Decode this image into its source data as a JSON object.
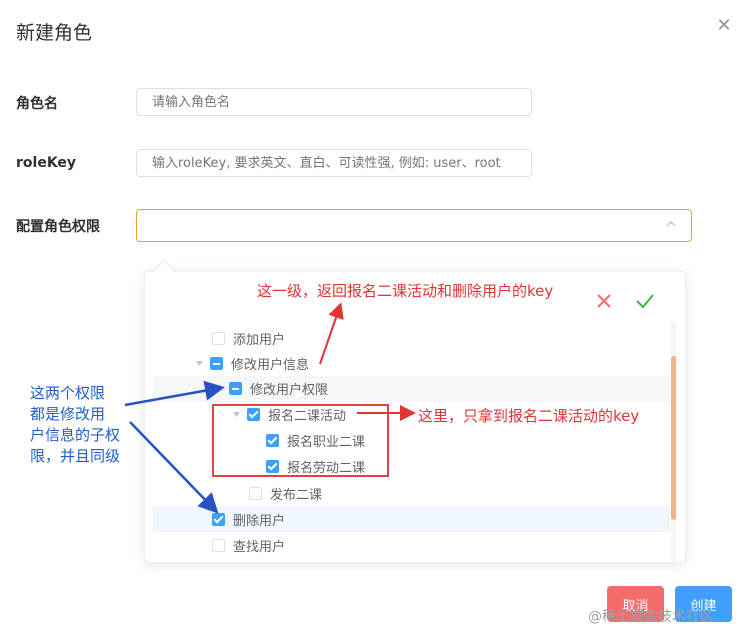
{
  "dialog": {
    "title": "新建角色",
    "close_icon": "close-icon"
  },
  "form": {
    "role_name": {
      "label": "角色名",
      "placeholder": "请输入角色名"
    },
    "role_key": {
      "label": "roleKey",
      "placeholder": "输入roleKey, 要求英文、直白、可读性强, 例如: user、root"
    },
    "permissions": {
      "label": "配置角色权限",
      "value": ""
    }
  },
  "tree": {
    "nodes": [
      {
        "label": "添加用户",
        "state": "unchecked",
        "expandable": false
      },
      {
        "label": "修改用户信息",
        "state": "indeterminate",
        "expandable": true,
        "expanded": true
      },
      {
        "label": "修改用户权限",
        "state": "indeterminate",
        "expandable": true,
        "expanded": true
      },
      {
        "label": "报名二课活动",
        "state": "checked",
        "expandable": true,
        "expanded": true
      },
      {
        "label": "报名职业二课",
        "state": "checked",
        "expandable": false
      },
      {
        "label": "报名劳动二课",
        "state": "checked",
        "expandable": false
      },
      {
        "label": "发布二课",
        "state": "unchecked",
        "expandable": false
      },
      {
        "label": "删除用户",
        "state": "checked",
        "expandable": false
      },
      {
        "label": "查找用户",
        "state": "unchecked",
        "expandable": false
      }
    ],
    "actions": {
      "cancel_icon": "close-x-icon",
      "confirm_icon": "check-icon"
    }
  },
  "annotations": {
    "top": "这一级，返回报名二课活动和删除用户的key",
    "right": "这里，只拿到报名二课活动的key",
    "left_lines": [
      "这两个权限",
      "都是修改用",
      "户信息的子权",
      "限，并且同级"
    ]
  },
  "buttons": {
    "cancel": "取消",
    "create": "创建"
  },
  "watermark": "@稀土掘金技术社区",
  "colors": {
    "primary": "#409eff",
    "danger": "#f56c6c",
    "focus_border": "#e6a23c",
    "annotation_red": "#e13434",
    "annotation_blue": "#1f5fc9",
    "confirm_green": "#3bb34a"
  }
}
